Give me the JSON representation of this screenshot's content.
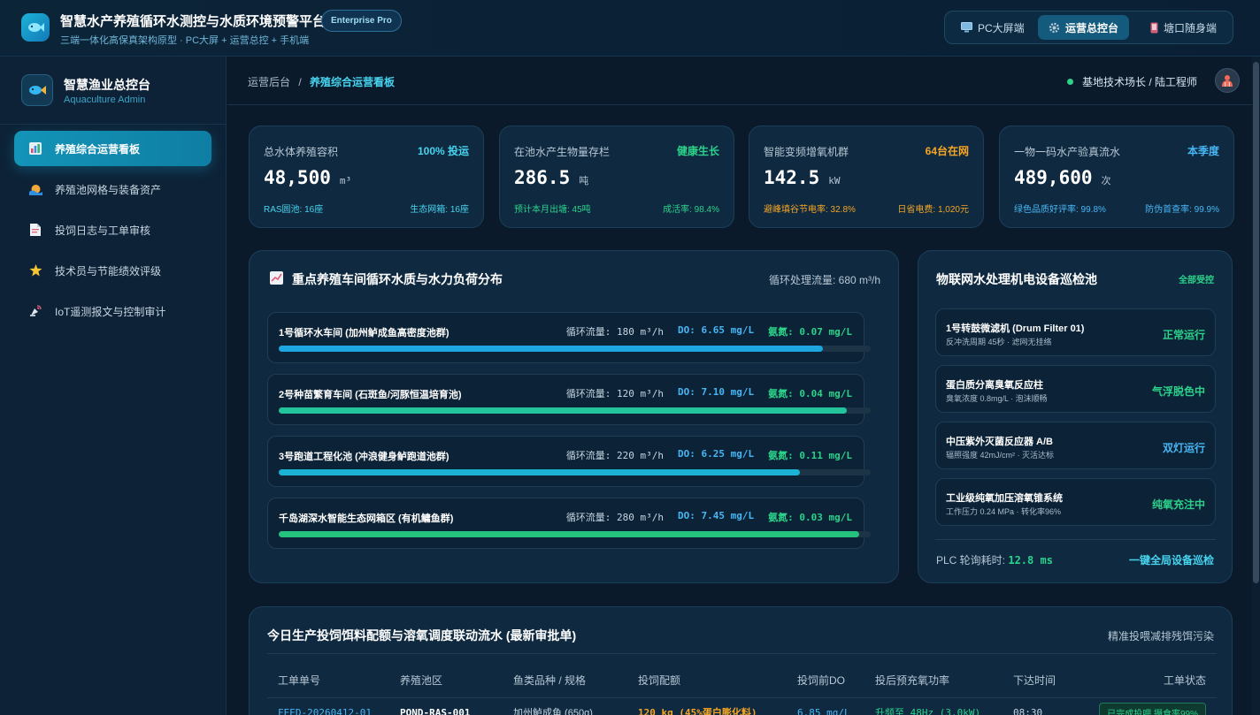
{
  "header": {
    "title": "智慧水产养殖循环水测控与水质环境预警平台",
    "subtitle": "三端一体化高保真架构原型 · PC大屏 + 运营总控 + 手机端",
    "edition": "Enterprise Pro",
    "modes": [
      {
        "label": "PC大屏端",
        "icon": "monitor-icon",
        "active": false
      },
      {
        "label": "运营总控台",
        "icon": "gear-icon",
        "active": true
      },
      {
        "label": "塘口随身端",
        "icon": "phone-icon",
        "active": false
      }
    ]
  },
  "sidebar": {
    "title": "智慧渔业总控台",
    "subtitle": "Aquaculture Admin",
    "items": [
      {
        "label": "养殖综合运营看板",
        "icon": "bar-chart-icon",
        "active": true
      },
      {
        "label": "养殖池网格与装备资产",
        "icon": "wave-icon",
        "active": false
      },
      {
        "label": "投饲日志与工单审核",
        "icon": "document-icon",
        "active": false
      },
      {
        "label": "技术员与节能绩效评级",
        "icon": "star-icon",
        "active": false
      },
      {
        "label": "IoT遥测报文与控制审计",
        "icon": "satellite-icon",
        "active": false
      }
    ]
  },
  "breadcrumb": {
    "root": "运营后台",
    "sep": "/",
    "current": "养殖综合运营看板"
  },
  "user": {
    "name": "基地技术场长 / 陆工程师",
    "status_color": "#2bd28a"
  },
  "kpis": [
    {
      "label": "总水体养殖容积",
      "badge": "100% 投运",
      "badge_color": "#47d4ef",
      "value": "48,500",
      "unit": "m³",
      "foot_left": "RAS圆池: 16座",
      "foot_right": "生态网箱: 16座",
      "foot_color": "#47d4ef"
    },
    {
      "label": "在池水产生物量存栏",
      "badge": "健康生长",
      "badge_color": "#2bd28a",
      "value": "286.5",
      "unit": "吨",
      "foot_left": "预计本月出塘: 45吨",
      "foot_right": "成活率: 98.4%",
      "foot_color": "#2bd28a"
    },
    {
      "label": "智能变频增氧机群",
      "badge": "64台在网",
      "badge_color": "#f5a524",
      "value": "142.5",
      "unit": "kW",
      "foot_left": "避峰填谷节电率: 32.8%",
      "foot_right": "日省电费: 1,020元",
      "foot_color": "#f5a524"
    },
    {
      "label": "一物一码水产验真流水",
      "badge": "本季度",
      "badge_color": "#47b6f5",
      "value": "489,600",
      "unit": "次",
      "foot_left": "绿色品质好评率: 99.8%",
      "foot_right": "防伪首查率: 99.9%",
      "foot_color": "#47b6f5"
    }
  ],
  "workshop_panel": {
    "title": "重点养殖车间循环水质与水力负荷分布",
    "icon": "trend-chart-icon",
    "total_flow_label": "循环处理流量:",
    "total_flow_value": "680 m³/h",
    "zones": [
      {
        "name": "1号循环水车间 (加州鲈成鱼高密度池群)",
        "flow": "循环流量: 180 m³/h",
        "do": "DO: 6.65 mg/L",
        "nh": "氨氮: 0.07 mg/L",
        "load": 0.92,
        "color": "#1da6e0"
      },
      {
        "name": "2号种苗繁育车间 (石斑鱼/河豚恒温培育池)",
        "flow": "循环流量: 120 m³/h",
        "do": "DO: 7.10 mg/L",
        "nh": "氨氮: 0.04 mg/L",
        "load": 0.96,
        "color": "#23c39b"
      },
      {
        "name": "3号跑道工程化池 (冲浪健身鲈跑道池群)",
        "flow": "循环流量: 220 m³/h",
        "do": "DO: 6.25 mg/L",
        "nh": "氨氮: 0.11 mg/L",
        "load": 0.88,
        "color": "#1cb2d6"
      },
      {
        "name": "千岛湖深水智能生态网箱区 (有机鳙鱼群)",
        "flow": "循环流量: 280 m³/h",
        "do": "DO: 7.45 mg/L",
        "nh": "氨氮: 0.03 mg/L",
        "load": 0.98,
        "color": "#25c27e"
      }
    ]
  },
  "device_panel": {
    "title": "物联网水处理机电设备巡检池",
    "badge": "全部受控",
    "devices": [
      {
        "name": "1号转鼓微滤机 (Drum Filter 01)",
        "sub": "反冲洗周期 45秒 · 滤网无挂络",
        "state": "正常运行",
        "color": "#2bd28a"
      },
      {
        "name": "蛋白质分离臭氧反应柱",
        "sub": "臭氧浓度 0.8mg/L · 泡沫顺畅",
        "state": "气浮脱色中",
        "color": "#2bd28a"
      },
      {
        "name": "中压紫外灭菌反应器 A/B",
        "sub": "辐照强度 42mJ/cm² · 灭活达标",
        "state": "双灯运行",
        "color": "#47b6f5"
      },
      {
        "name": "工业级纯氧加压溶氧锥系统",
        "sub": "工作压力 0.24 MPa · 转化率96%",
        "state": "纯氧充注中",
        "color": "#2bd28a"
      }
    ],
    "plc_label": "PLC 轮询耗时:",
    "plc_value": "12.8 ms",
    "patrol_button": "一键全局设备巡检"
  },
  "orders_panel": {
    "title": "今日生产投饲饵料配额与溶氧调度联动流水 (最新审批单)",
    "right_note": "精准投喂减排残饵污染",
    "columns": [
      "工单单号",
      "养殖池区",
      "鱼类品种 / 规格",
      "投饲配额",
      "投饲前DO",
      "投后预充氧功率",
      "下达时间",
      "工单状态"
    ],
    "rows": [
      {
        "id": "FEED-20260412-01",
        "pond": "POND-RAS-001",
        "species": "加州鲈成鱼 (650g)",
        "quota": "120 kg (45%蛋白膨化料)",
        "do": "6.85 mg/L",
        "power": "升频至 48Hz (3.0kW)",
        "time": "08:30",
        "status": "已完成投喂 摄食率99%"
      }
    ]
  }
}
